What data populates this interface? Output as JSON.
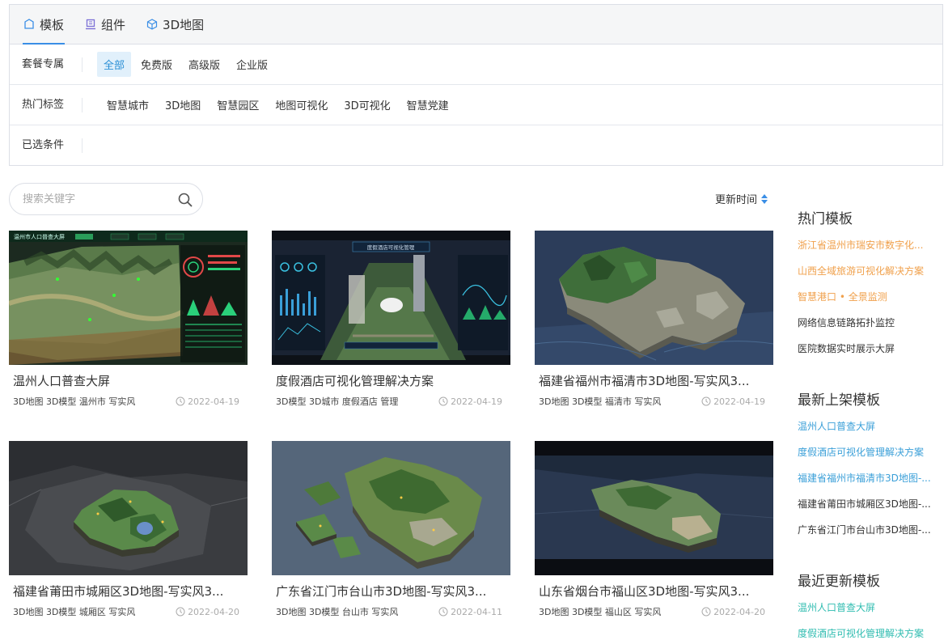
{
  "tabs": [
    {
      "label": "模板",
      "icon": "template-icon"
    },
    {
      "label": "组件",
      "icon": "component-icon"
    },
    {
      "label": "3D地图",
      "icon": "cube-icon"
    }
  ],
  "filters": {
    "package": {
      "label": "套餐专属",
      "options": [
        "全部",
        "免费版",
        "高级版",
        "企业版"
      ],
      "selected": "全部"
    },
    "hot_tags": {
      "label": "热门标签",
      "options": [
        "智慧城市",
        "3D地图",
        "智慧园区",
        "地图可视化",
        "3D可视化",
        "智慧党建"
      ]
    },
    "selected": {
      "label": "已选条件"
    }
  },
  "search": {
    "placeholder": "搜索关键字"
  },
  "sort": {
    "label": "更新时间"
  },
  "cards": [
    {
      "title": "温州人口普查大屏",
      "tags": "3D地图 3D模型 温州市 写实风",
      "date": "2022-04-19",
      "thumb_header": "温州市人口普查大屏"
    },
    {
      "title": "度假酒店可视化管理解决方案",
      "tags": "3D模型 3D城市 度假酒店 管理",
      "date": "2022-04-19",
      "thumb_header": "度假酒店可视化管理"
    },
    {
      "title": "福建省福州市福清市3D地图-写实风3...",
      "tags": "3D地图 3D模型 福清市 写实风",
      "date": "2022-04-19"
    },
    {
      "title": "福建省莆田市城厢区3D地图-写实风3...",
      "tags": "3D地图 3D模型 城厢区 写实风",
      "date": "2022-04-20"
    },
    {
      "title": "广东省江门市台山市3D地图-写实风3...",
      "tags": "3D地图 3D模型 台山市 写实风",
      "date": "2022-04-11"
    },
    {
      "title": "山东省烟台市福山区3D地图-写实风3...",
      "tags": "3D地图 3D模型 福山区 写实风",
      "date": "2022-04-20"
    }
  ],
  "sidebar": {
    "hot": {
      "title": "热门模板",
      "items": [
        {
          "label": "浙江省温州市瑞安市数字化...",
          "color": "#f0a04b"
        },
        {
          "label": "山西全域旅游可视化解决方案",
          "color": "#f0a04b"
        },
        {
          "label": "智慧港口 • 全景监测",
          "color": "#f0a04b"
        },
        {
          "label": "网络信息链路拓扑监控",
          "color": "#333333"
        },
        {
          "label": "医院数据实时展示大屏",
          "color": "#333333"
        }
      ]
    },
    "latest": {
      "title": "最新上架模板",
      "items": [
        {
          "label": "温州人口普查大屏",
          "color": "#3a9fd8"
        },
        {
          "label": "度假酒店可视化管理解决方案",
          "color": "#3a9fd8"
        },
        {
          "label": "福建省福州市福清市3D地图-...",
          "color": "#3a9fd8"
        },
        {
          "label": "福建省莆田市城厢区3D地图-...",
          "color": "#333333"
        },
        {
          "label": "广东省江门市台山市3D地图-...",
          "color": "#333333"
        }
      ]
    },
    "recent": {
      "title": "最近更新模板",
      "items": [
        {
          "label": "温州人口普查大屏",
          "color": "#2fbcb0"
        },
        {
          "label": "度假酒店可视化管理解决方案",
          "color": "#2fbcb0"
        }
      ]
    }
  },
  "colors": {
    "accent": "#3a8ee6",
    "chip_bg": "#e1f0fb",
    "hot_orange": "#f0a04b",
    "latest_blue": "#3a9fd8",
    "recent_teal": "#2fbcb0"
  }
}
